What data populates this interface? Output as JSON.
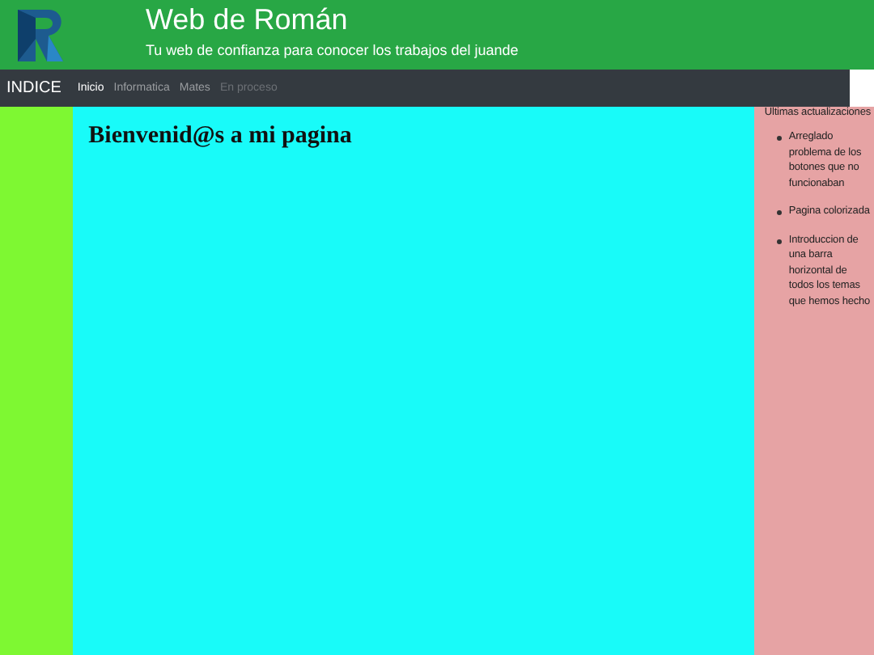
{
  "header": {
    "title": "Web de Román",
    "subtitle": "Tu web de confianza para conocer los trabajos del juande"
  },
  "nav": {
    "brand": "INDICE",
    "items": [
      {
        "label": "Inicio",
        "selected": true,
        "disabled": false
      },
      {
        "label": "Informatica",
        "selected": false,
        "disabled": false
      },
      {
        "label": "Mates",
        "selected": false,
        "disabled": false
      },
      {
        "label": "En proceso",
        "selected": false,
        "disabled": true
      }
    ]
  },
  "main": {
    "heading": "Bienvenid@s a mi pagina"
  },
  "sidebar": {
    "title": "Ultimas actualizaciones",
    "items": [
      "Arreglado problema de los botones que no funcionaban",
      "Pagina colorizada",
      "Introduccion de una barra horizontal de todos los temas que hemos hecho"
    ]
  }
}
